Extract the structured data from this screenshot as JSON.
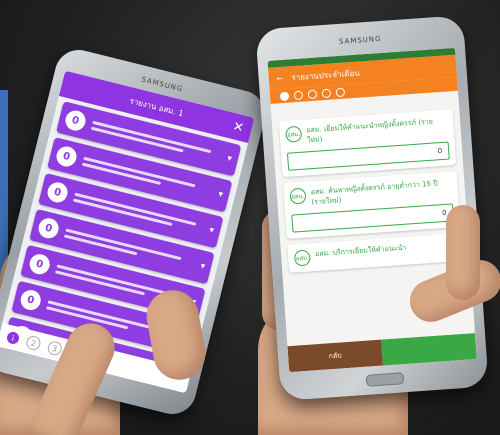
{
  "left_phone": {
    "brand": "SAMSUNG",
    "header_title": "รายงาน อสม. 1",
    "close_icon": "close-icon",
    "cards": [
      {
        "count": "0"
      },
      {
        "count": "0"
      },
      {
        "count": "0"
      },
      {
        "count": "0"
      },
      {
        "count": "0"
      },
      {
        "count": "0"
      },
      {
        "count": "0"
      }
    ],
    "footer_steps": [
      "i",
      "2",
      "3"
    ]
  },
  "right_phone": {
    "brand": "SAMSUNG",
    "header_title": "รายงานประจำเดือน",
    "steps": 5,
    "active_step": 1,
    "questions": [
      {
        "badge": "อสม.",
        "text": "อสม. เยี่ยมให้คำแนะนำหญิงตั้งครรภ์ (รายใหม่)",
        "value": "0"
      },
      {
        "badge": "อสม.",
        "text": "อสม. ค้นหาหญิงตั้งครรภ์ อายุต่ำกว่า 15 ปี (รายใหม่)",
        "value": "0"
      },
      {
        "badge": "อสม.",
        "text": "อสม. บริการเยี่ยมให้คำแนะนำ",
        "value": ""
      }
    ],
    "back_label": "กลับ",
    "colors": {
      "header": "#f58220",
      "accent": "#39a845",
      "status": "#2e7d32"
    }
  },
  "left_colors": {
    "header": "#8e34e0",
    "card": "#8d3de0"
  }
}
